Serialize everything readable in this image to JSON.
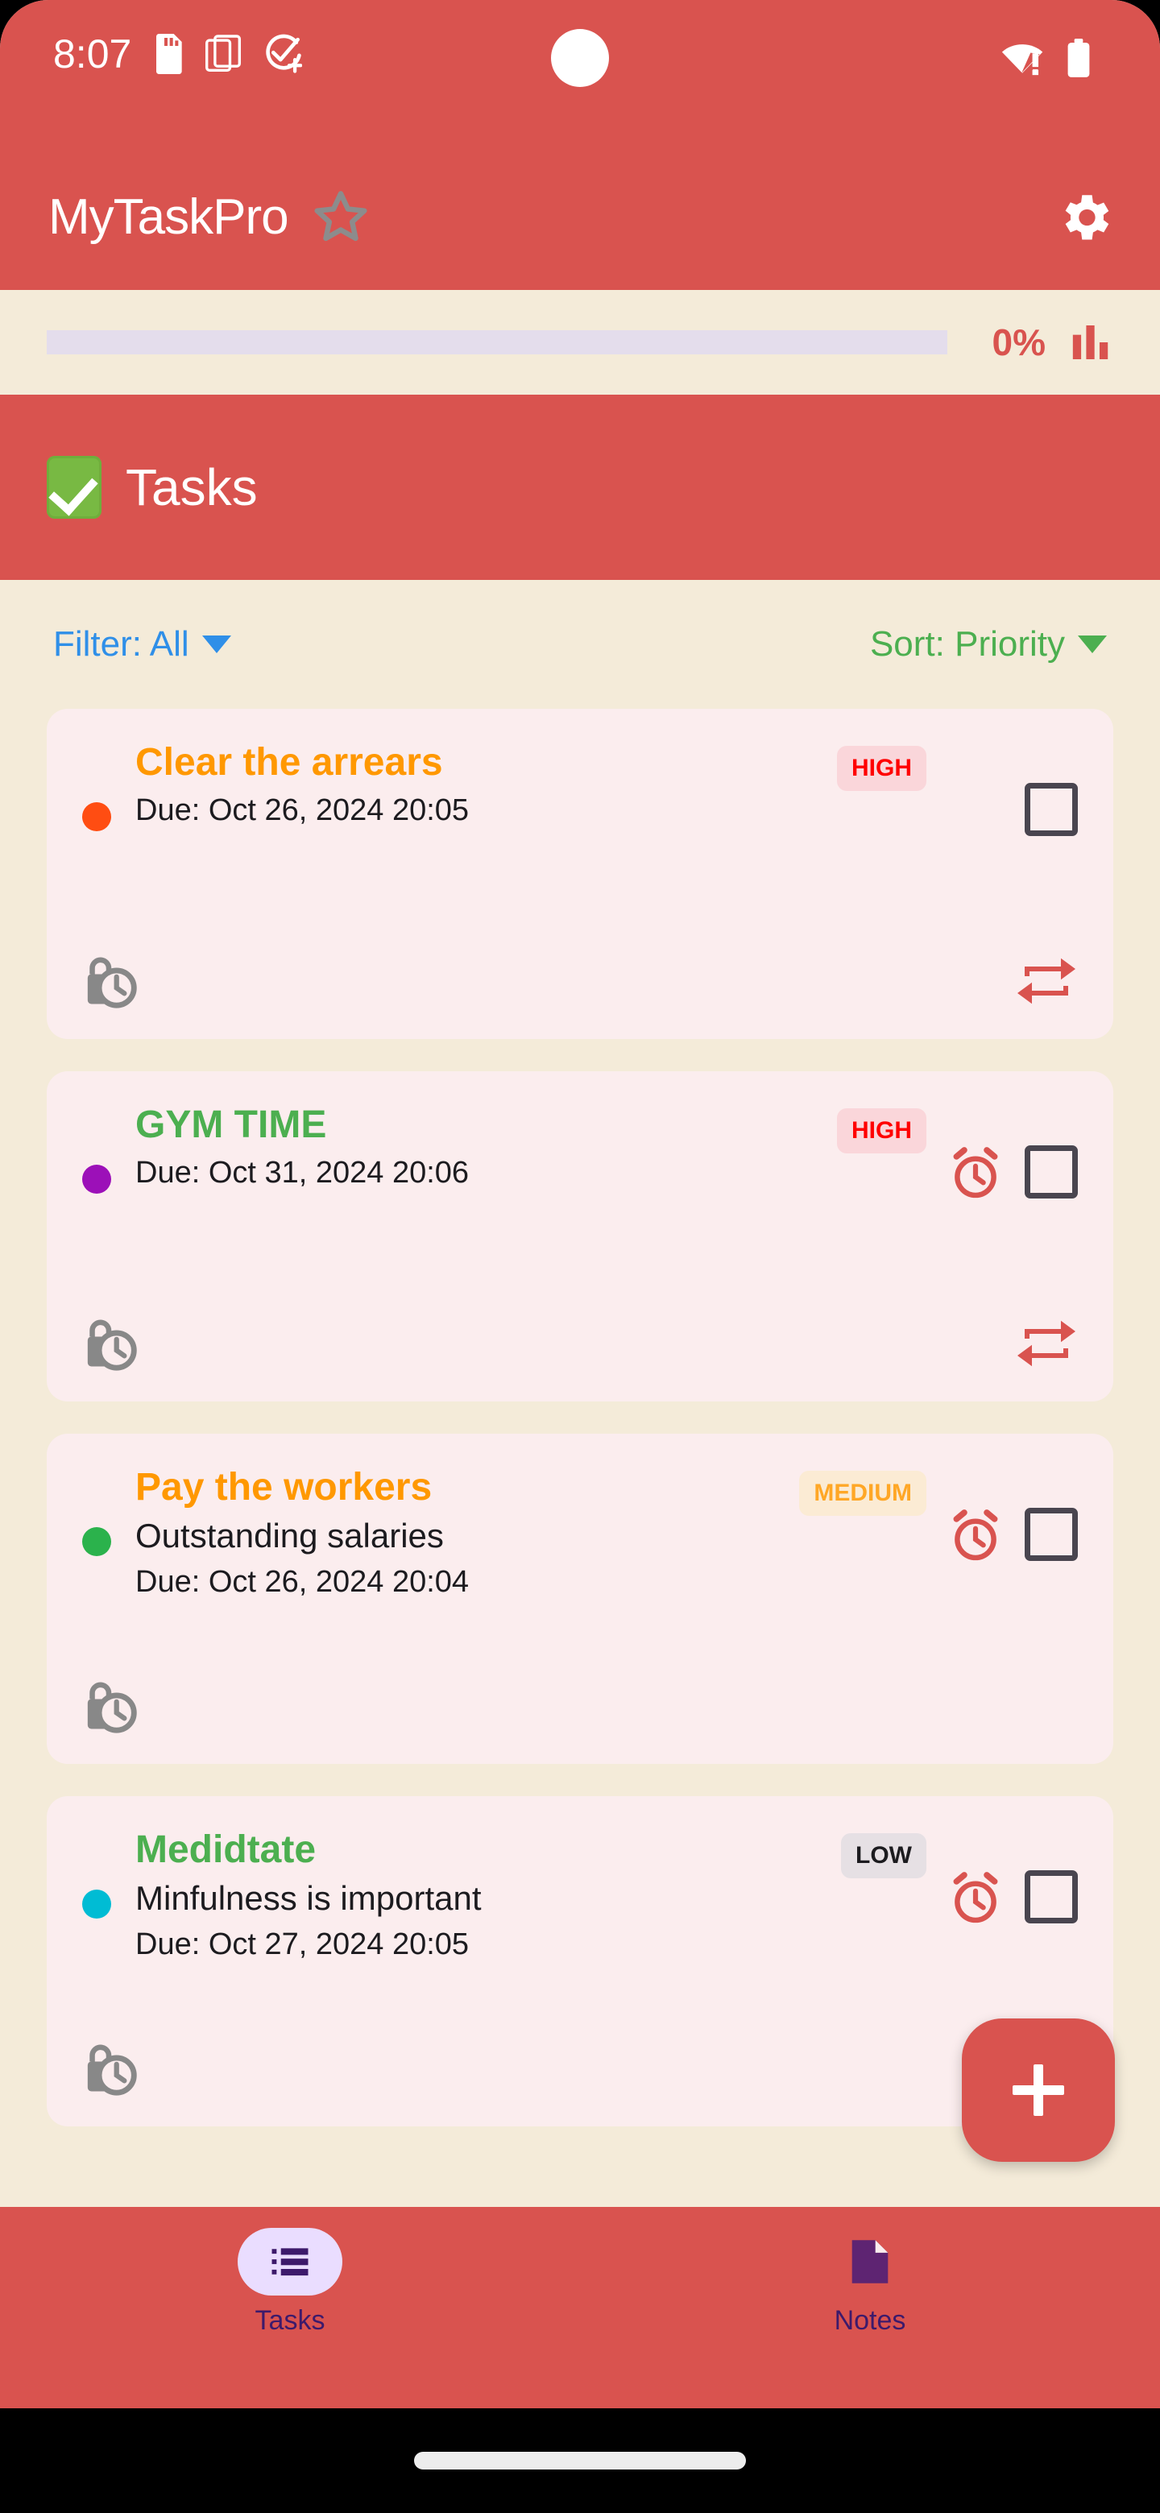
{
  "status_bar": {
    "time": "8:07",
    "left_icons": [
      "sd-card-icon",
      "multi-window-icon",
      "task-check-add-icon"
    ],
    "right_icons": [
      "wifi-no-internet-icon",
      "battery-full-icon"
    ]
  },
  "app_bar": {
    "title": "MyTaskPro",
    "star_icon": "star-outline-icon",
    "settings_icon": "gear-icon"
  },
  "progress": {
    "percent_label": "0%",
    "percent_value": 0,
    "stats_icon": "bar-chart-icon",
    "track_color": "#E4DDEC",
    "accent_color": "#D9534F"
  },
  "section": {
    "icon": "green-check-box-emoji",
    "title": "Tasks"
  },
  "controls": {
    "filter": {
      "label": "Filter: All",
      "color": "#2F8FE8",
      "caret": "chevron-down-icon"
    },
    "sort": {
      "label": "Sort: Priority",
      "color": "#4CAF50",
      "caret": "chevron-down-icon"
    }
  },
  "tasks": [
    {
      "title": "Clear the arrears",
      "title_color": "#FF9800",
      "description": "",
      "due": "Due: Oct 26, 2024 20:05",
      "priority": "HIGH",
      "priority_class": "badge-high",
      "dot_color": "#FF4D12",
      "has_alarm": false,
      "has_repeat": true,
      "pending_icon": "lock-clock-icon",
      "checked": false
    },
    {
      "title": "GYM TIME",
      "title_color": "#4CAF50",
      "description": "",
      "due": "Due: Oct 31, 2024 20:06",
      "priority": "HIGH",
      "priority_class": "badge-high",
      "dot_color": "#9C10B8",
      "has_alarm": true,
      "has_repeat": true,
      "pending_icon": "lock-clock-icon",
      "checked": false
    },
    {
      "title": "Pay the workers",
      "title_color": "#FF9800",
      "description": "Outstanding salaries",
      "due": "Due: Oct 26, 2024 20:04",
      "priority": "MEDIUM",
      "priority_class": "badge-medium",
      "dot_color": "#2BB24C",
      "has_alarm": true,
      "has_repeat": false,
      "pending_icon": "lock-clock-icon",
      "checked": false
    },
    {
      "title": "Medidtate",
      "title_color": "#4CAF50",
      "description": "Minfulness is important",
      "due": "Due: Oct 27, 2024 20:05",
      "priority": "LOW",
      "priority_class": "badge-low",
      "dot_color": "#00BCD4",
      "has_alarm": true,
      "has_repeat": false,
      "pending_icon": "lock-clock-icon",
      "checked": false
    }
  ],
  "fab": {
    "icon": "plus-icon",
    "color": "#D9534F"
  },
  "bottom_nav": {
    "items": [
      {
        "label": "Tasks",
        "icon": "list-icon",
        "active": true
      },
      {
        "label": "Notes",
        "icon": "note-document-icon",
        "active": false
      }
    ],
    "active_pill_color": "#EADDFF",
    "label_color": "#3D1A6B"
  }
}
